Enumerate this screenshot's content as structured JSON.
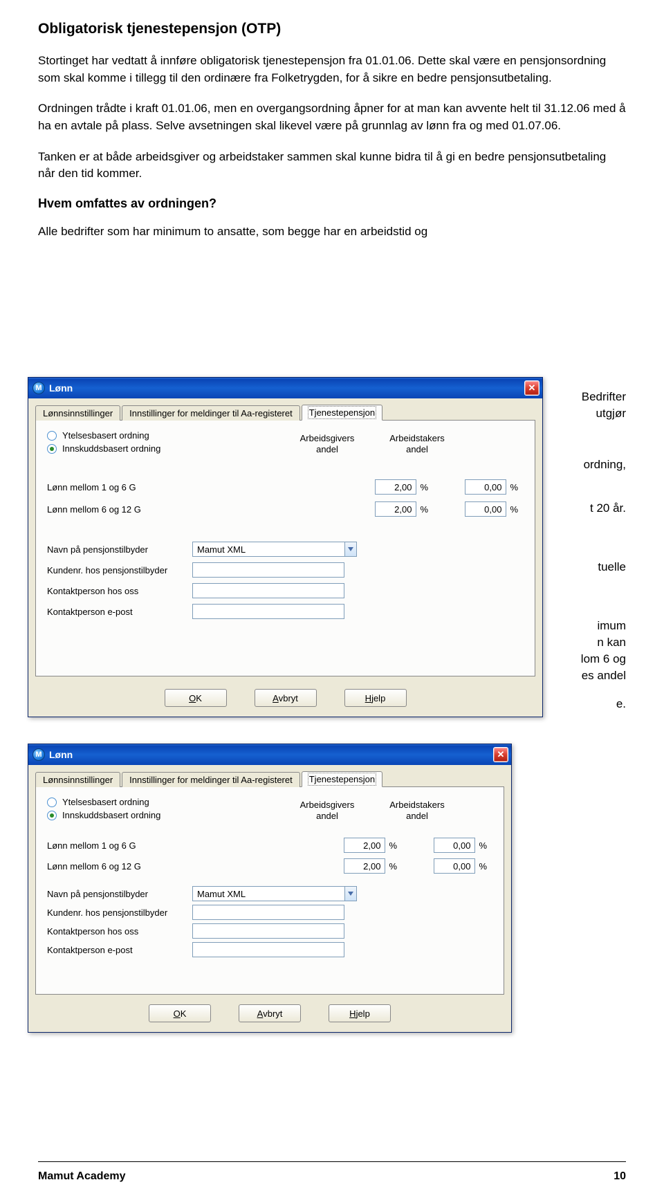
{
  "doc": {
    "title": "Obligatorisk tjenestepensjon (OTP)",
    "p1": "Stortinget har vedtatt å innføre obligatorisk tjenestepensjon fra 01.01.06. Dette skal være en pensjonsordning som skal komme i tillegg til den ordinære fra Folketrygden, for å sikre en bedre pensjonsutbetaling.",
    "p2": "Ordningen trådte i kraft 01.01.06, men en overgangsordning åpner for at man kan avvente helt til 31.12.06 med å ha en avtale på plass. Selve avsetningen skal likevel være på grunnlag av lønn fra og med 01.07.06.",
    "p3": "Tanken er at både arbeidsgiver og arbeidstaker sammen skal kunne bidra til å gi en bedre pensjonsutbetaling når den tid kommer.",
    "sub1": "Hvem omfattes av ordningen?",
    "p4": "Alle bedrifter som har minimum to ansatte, som begge har en arbeidstid og",
    "bg1a": "Bedrifter",
    "bg1b": "utgjør",
    "bg2a": "ordning,",
    "bg3a": "t 20 år.",
    "bg4a": "tuelle",
    "bg5a": "imum",
    "bg5b": "n kan",
    "bg5c": "lom 6 og",
    "bg5d": "es andel",
    "bg6": "e.",
    "footer_left": "Mamut Academy",
    "footer_right": "10"
  },
  "dialog": {
    "title": "Lønn",
    "app_letter": "M",
    "close": "✕",
    "tabs": {
      "t1": "Lønnsinnstillinger",
      "t2": "Innstillinger for meldinger til Aa-registeret",
      "t3": "Tjenestepensjon"
    },
    "radios": {
      "r1": "Ytelsesbasert ordning",
      "r2": "Innskuddsbasert ordning"
    },
    "colheads": {
      "c1a": "Arbeidsgivers",
      "c1b": "andel",
      "c2a": "Arbeidstakers",
      "c2b": "andel"
    },
    "rows": {
      "r1": "Lønn mellom 1 og 6 G",
      "r2": "Lønn mellom 6 og 12 G",
      "v_emp": "2,00",
      "v_wrk": "0,00",
      "pct": "%"
    },
    "fields": {
      "f1": "Navn på pensjonstilbyder",
      "f2": "Kundenr. hos pensjonstilbyder",
      "f3": "Kontaktperson hos oss",
      "f4": "Kontaktperson e-post",
      "provider": "Mamut XML"
    },
    "buttons": {
      "ok1": "O",
      "ok2": "K",
      "av1": "A",
      "av2": "vbryt",
      "hj1": "H",
      "hj2": "jelp"
    }
  }
}
